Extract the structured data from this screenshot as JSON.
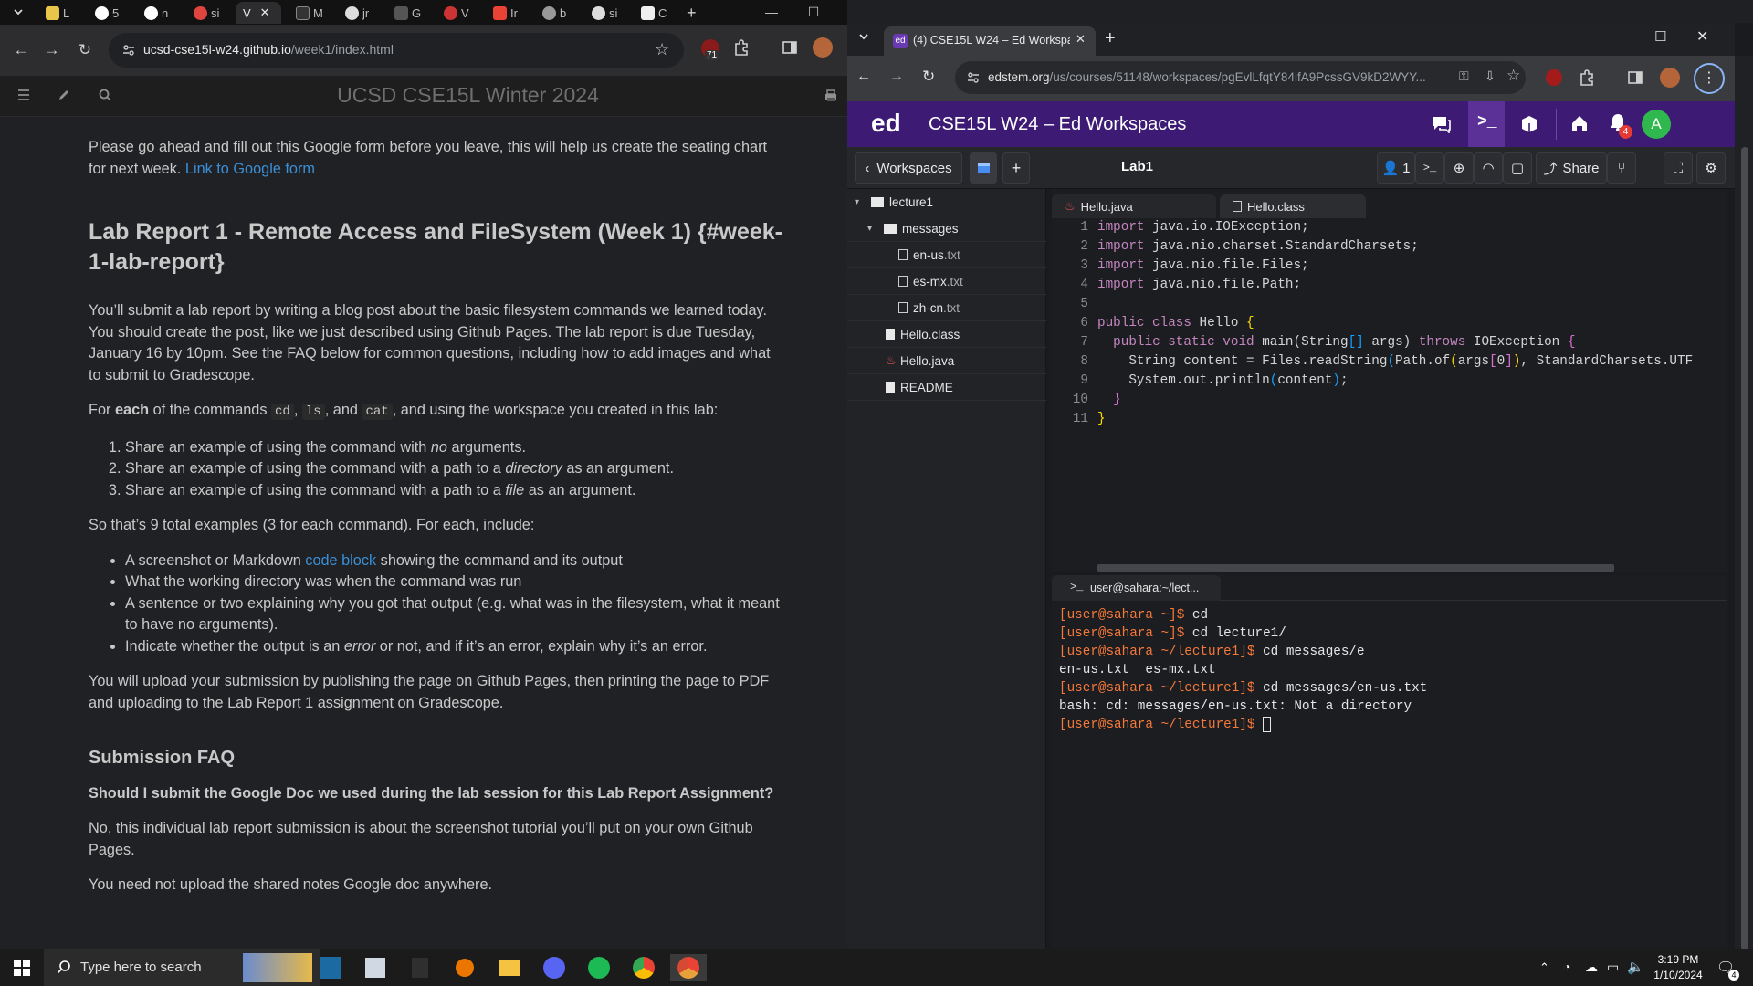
{
  "left_browser": {
    "tabs": [
      {
        "label": "L"
      },
      {
        "label": "5"
      },
      {
        "label": "n"
      },
      {
        "label": "si"
      },
      {
        "label": "V"
      },
      {
        "label": "M"
      },
      {
        "label": "jr"
      },
      {
        "label": "G"
      },
      {
        "label": "V"
      },
      {
        "label": "Ir"
      },
      {
        "label": "b"
      },
      {
        "label": "si"
      },
      {
        "label": "C"
      }
    ],
    "url_host": "ucsd-cse15l-w24.github.io",
    "url_path": "/week1/index.html",
    "extension_badge": "71",
    "site_title": "UCSD CSE15L Winter 2024"
  },
  "content": {
    "intro": "Please go ahead and fill out this Google form before you leave, this will help us create the seating chart for next week.",
    "intro_link": "Link to Google form",
    "heading": "Lab Report 1 - Remote Access and FileSystem (Week 1) {#week-1-lab-report}",
    "para1": "You’ll submit a lab report by writing a blog post about the basic filesystem commands we learned today. You should create the post, like we just described using Github Pages. The lab report is due Tuesday, January 16 by 10pm. See the FAQ below for common questions, including how to add images and what to submit to Gradescope.",
    "para2_a": "For",
    "para2_b": "each",
    "para2_c": "of the commands",
    "cmd_cd": "cd",
    "cmd_ls": "ls",
    "para2_d": ", and",
    "cmd_cat": "cat",
    "para2_e": ", and using the workspace you created in this lab:",
    "ol_1a": "Share an example of using the command with",
    "ol_1b": "no",
    "ol_1c": "arguments.",
    "ol_2a": "Share an example of using the command with a path to a",
    "ol_2b": "directory",
    "ol_2c": "as an argument.",
    "ol_3a": "Share an example of using the command with a path to a",
    "ol_3b": "file",
    "ol_3c": "as an argument.",
    "para3": "So that’s 9 total examples (3 for each command). For each, include:",
    "ul_1a": "A screenshot or Markdown",
    "ul_1b": "code block",
    "ul_1c": "showing the command and its output",
    "ul_2": "What the working directory was when the command was run",
    "ul_3": "A sentence or two explaining why you got that output (e.g. what was in the filesystem, what it meant to have no arguments).",
    "ul_4a": "Indicate whether the output is an",
    "ul_4b": "error",
    "ul_4c": "or not, and if it’s an error, explain why it’s an error.",
    "para4": "You will upload your submission by publishing the page on Github Pages, then printing the page to PDF and uploading to the Lab Report 1 assignment on Gradescope.",
    "faq_heading": "Submission FAQ",
    "faq_q1": "Should I submit the Google Doc we used during the lab session for this Lab Report Assignment?",
    "faq_a1": "No, this individual lab report submission is about the screenshot tutorial you’ll put on your own Github Pages.",
    "faq_a2": "You need not upload the shared notes Google doc anywhere."
  },
  "right_browser": {
    "tab_title": "(4) CSE15L W24 – Ed Workspac",
    "url_host": "edstem.org",
    "url_path": "/us/courses/51148/workspaces/pgEvlLfqtY84ifA9PcssGV9kD2WYY...",
    "ed_logo": "ed",
    "ed_title": "CSE15L W24 – Ed Workspaces",
    "notif_count": "4",
    "avatar_letter": "A",
    "workspaces_label": "Workspaces",
    "workspace_name": "Lab1",
    "users_count": "1",
    "share_label": "Share",
    "tree": [
      {
        "name": "lecture1",
        "type": "folder"
      },
      {
        "name": "messages",
        "type": "folder"
      },
      {
        "name": "en-us",
        "ext": ".txt"
      },
      {
        "name": "es-mx",
        "ext": ".txt"
      },
      {
        "name": "zh-cn",
        "ext": ".txt"
      },
      {
        "name": "Hello.class",
        "ext": ""
      },
      {
        "name": "Hello.java",
        "ext": ""
      },
      {
        "name": "README",
        "ext": ""
      }
    ],
    "editor_tabs": [
      "Hello.java",
      "Hello.class"
    ],
    "code_lines": [
      "1",
      "2",
      "3",
      "4",
      "5",
      "6",
      "7",
      "8",
      "9",
      "10",
      "11"
    ],
    "terminal_tab": "user@sahara:~/lect...",
    "terminal": {
      "p1": "[user@sahara ~]$",
      "c1": " cd",
      "p2": "[user@sahara ~]$",
      "c2": " cd lecture1/",
      "p3": "[user@sahara ~/lecture1]$",
      "c3": " cd messages/e",
      "o3": "en-us.txt  es-mx.txt",
      "p4": "[user@sahara ~/lecture1]$",
      "c4": " cd messages/en-us.txt",
      "o4": "bash: cd: messages/en-us.txt: Not a directory",
      "p5": "[user@sahara ~/lecture1]$"
    }
  },
  "taskbar": {
    "search_placeholder": "Type here to search",
    "time": "3:19 PM",
    "date": "1/10/2024",
    "notification_count": "4"
  }
}
